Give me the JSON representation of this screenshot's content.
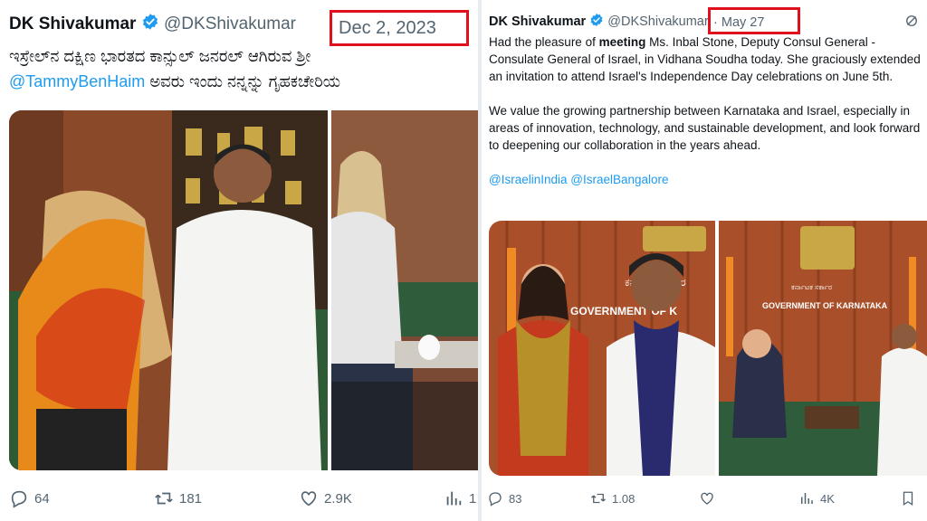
{
  "left_tweet": {
    "author_name": "DK Shivakumar",
    "handle": "@DKShivakumar",
    "date": "Dec 2, 2023",
    "kannada_line1": "ಇಸ್ರೇಲ್‌ನ ದಕ್ಷಿಣ ಭಾರತದ ಕಾನ್ಸುಲ್ ಜನರಲ್ ಆಗಿರುವ ಶ್ರೀ",
    "mention": "@TammyBenHaim",
    "kannada_line2": " ಅವರು ಇಂದು ನನ್ನನ್ನು ಗೃಹಕಚೇರಿಯ",
    "actions": {
      "replies": "64",
      "reposts": "181",
      "likes": "2.9K",
      "views": "1"
    }
  },
  "right_tweet": {
    "author_name": "DK Shivakumar",
    "handle": "@DKShivakumar",
    "separator": "·",
    "date": "May 27",
    "para1_a": "Had the pleasure of ",
    "para1_b": "meeting",
    "para1_c": " Ms. Inbal Stone, Deputy Consul General - Consulate General of Israel, in Vidhana Soudha today. She graciously extended an invitation to attend Israel's Independence Day celebrations on June 5th.",
    "para2": "We value the growing partnership between Karnataka and Israel, especially in areas of innovation, technology, and sustainable development, and look forward to deepening our collaboration in the years ahead.",
    "mentions": "@IsraelinIndia @IsraelBangalore",
    "photo_sign_text": "GOVERNMENT OF KARNATAKA",
    "photo_sign_text_short": "GOVERNMENT OF K",
    "photo_sign_kannada": "ಕರ್ನಾಟಕ ಸರ್ಕಾರ",
    "actions": {
      "replies": "83",
      "reposts": "1.08",
      "likes": "",
      "views": "4K"
    }
  },
  "colors": {
    "accent_blue": "#1d9bf0",
    "highlight_red": "#e0101e",
    "text_primary": "#0f1419",
    "text_secondary": "#536471"
  }
}
